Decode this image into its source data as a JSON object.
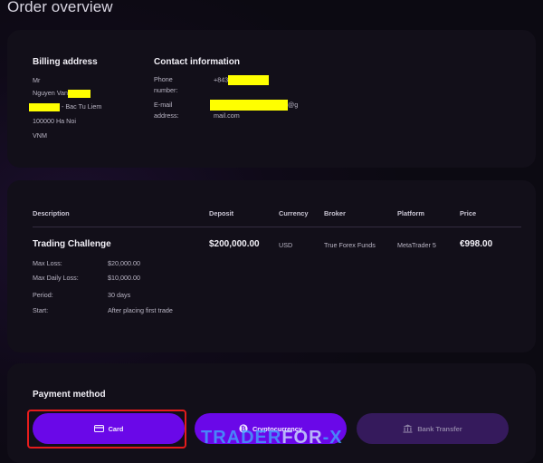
{
  "page": {
    "title": "Order overview"
  },
  "billing": {
    "heading": "Billing address",
    "title": "Mr",
    "name_prefix": "Nguyen Van",
    "address_suffix": "- Bac Tu Liem",
    "postcode_city": "100000 Ha Noi",
    "country": "VNM"
  },
  "contact": {
    "heading": "Contact information",
    "phone_label_1": "Phone",
    "phone_label_2": "number:",
    "phone_prefix": "+843",
    "email_label_1": "E-mail",
    "email_label_2": "address:",
    "email_suffix_1": "@g",
    "email_suffix_2": "mail.com"
  },
  "order": {
    "columns": [
      "Description",
      "Deposit",
      "Currency",
      "Broker",
      "Platform",
      "Price"
    ],
    "product": {
      "name": "Trading Challenge",
      "deposit": "$200,000.00",
      "currency": "USD",
      "broker": "True Forex Funds",
      "platform": "MetaTrader 5",
      "price": "€998.00"
    },
    "details": [
      {
        "label": "Max Loss:",
        "value": "$20,000.00"
      },
      {
        "label": "Max Daily Loss:",
        "value": "$10,000.00"
      },
      {
        "label": "Period:",
        "value": "30 days"
      },
      {
        "label": "Start:",
        "value": "After placing first trade"
      }
    ]
  },
  "payment": {
    "heading": "Payment method",
    "options": [
      {
        "label": "Card",
        "icon": "card-icon",
        "state": "selected"
      },
      {
        "label": "Cryptocurrency",
        "icon": "bitcoin-icon",
        "state": "available"
      },
      {
        "label": "Bank Transfer",
        "icon": "bank-icon",
        "state": "disabled"
      }
    ]
  },
  "watermark": {
    "part1": "TRADER",
    "part2": "FOR",
    "part3": "-X"
  },
  "colors": {
    "accent": "#6a08e8",
    "disabled": "#351a5c",
    "highlight": "#ffff00",
    "annotation": "#e51c1c"
  }
}
